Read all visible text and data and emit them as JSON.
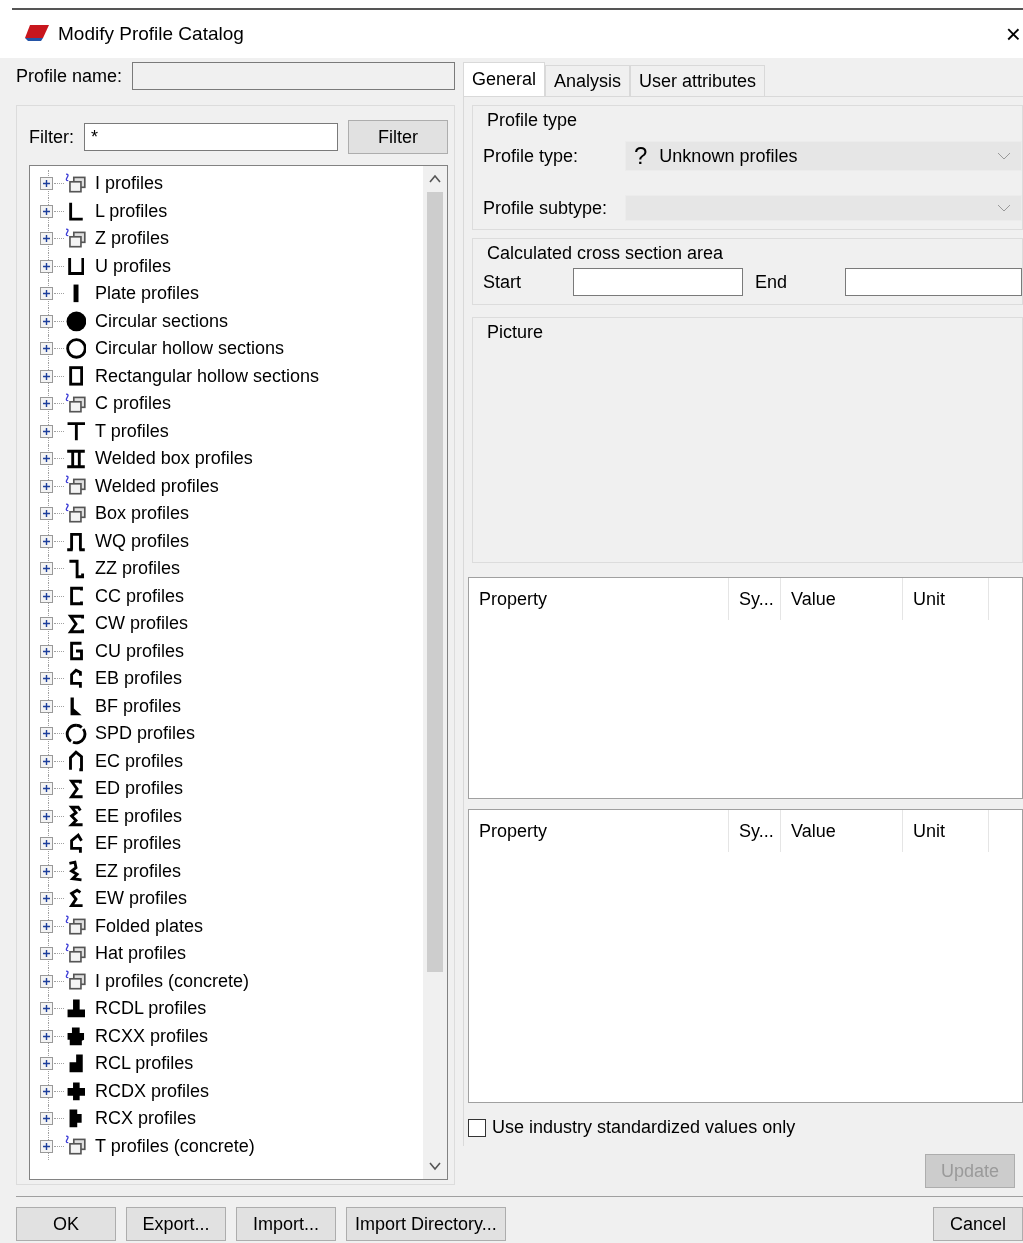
{
  "window": {
    "title": "Modify Profile Catalog",
    "close": "×"
  },
  "profile_name": {
    "label": "Profile name:"
  },
  "filter": {
    "label": "Filter:",
    "value": "*",
    "button": "Filter"
  },
  "tree": {
    "items": [
      {
        "label": "I profiles",
        "kind": "catalog"
      },
      {
        "label": "L profiles",
        "kind": "L"
      },
      {
        "label": "Z profiles",
        "kind": "catalog"
      },
      {
        "label": "U profiles",
        "kind": "U"
      },
      {
        "label": "Plate profiles",
        "kind": "plate"
      },
      {
        "label": "Circular sections",
        "kind": "disc"
      },
      {
        "label": "Circular hollow sections",
        "kind": "ring"
      },
      {
        "label": "Rectangular hollow sections",
        "kind": "rect"
      },
      {
        "label": "C profiles",
        "kind": "catalog"
      },
      {
        "label": "T profiles",
        "kind": "T"
      },
      {
        "label": "Welded box profiles",
        "kind": "weldedbox"
      },
      {
        "label": "Welded profiles",
        "kind": "catalog"
      },
      {
        "label": "Box profiles",
        "kind": "catalog"
      },
      {
        "label": "WQ profiles",
        "kind": "WQ"
      },
      {
        "label": "ZZ profiles",
        "kind": "ZZ"
      },
      {
        "label": "CC profiles",
        "kind": "CC"
      },
      {
        "label": "CW profiles",
        "kind": "CW"
      },
      {
        "label": "CU profiles",
        "kind": "CU"
      },
      {
        "label": "EB profiles",
        "kind": "EB"
      },
      {
        "label": "BF profiles",
        "kind": "BF"
      },
      {
        "label": "SPD profiles",
        "kind": "SPD"
      },
      {
        "label": "EC profiles",
        "kind": "EC"
      },
      {
        "label": "ED profiles",
        "kind": "ED"
      },
      {
        "label": "EE profiles",
        "kind": "EE"
      },
      {
        "label": "EF profiles",
        "kind": "EF"
      },
      {
        "label": "EZ profiles",
        "kind": "EZ"
      },
      {
        "label": "EW profiles",
        "kind": "EW"
      },
      {
        "label": "Folded plates",
        "kind": "catalog"
      },
      {
        "label": "Hat profiles",
        "kind": "catalog"
      },
      {
        "label": "I profiles (concrete)",
        "kind": "catalog"
      },
      {
        "label": "RCDL profiles",
        "kind": "RCDL"
      },
      {
        "label": "RCXX profiles",
        "kind": "RCXX"
      },
      {
        "label": "RCL profiles",
        "kind": "RCL"
      },
      {
        "label": "RCDX profiles",
        "kind": "RCDX"
      },
      {
        "label": "RCX profiles",
        "kind": "RCX"
      },
      {
        "label": "T profiles (concrete)",
        "kind": "catalog"
      }
    ]
  },
  "tabs": [
    {
      "label": "General",
      "selected": true
    },
    {
      "label": "Analysis",
      "selected": false
    },
    {
      "label": "User attributes",
      "selected": false
    }
  ],
  "profile_type": {
    "title": "Profile type",
    "type_label": "Profile type:",
    "type_icon": "?",
    "type_value": "Unknown profiles",
    "subtype_label": "Profile subtype:"
  },
  "area": {
    "title": "Calculated cross section area",
    "start_label": "Start",
    "end_label": "End"
  },
  "picture": {
    "title": "Picture"
  },
  "tables": [
    {
      "columns": [
        "Property",
        "Sy...",
        "Value",
        "Unit"
      ]
    },
    {
      "columns": [
        "Property",
        "Sy...",
        "Value",
        "Unit"
      ]
    }
  ],
  "industry_checkbox": {
    "label": "Use industry standardized values only",
    "checked": false
  },
  "update_button": {
    "label": "Update",
    "disabled": true
  },
  "buttons": [
    {
      "label": "OK"
    },
    {
      "label": "Export..."
    },
    {
      "label": "Import..."
    },
    {
      "label": "Import Directory..."
    }
  ],
  "cancel_button": {
    "label": "Cancel"
  }
}
